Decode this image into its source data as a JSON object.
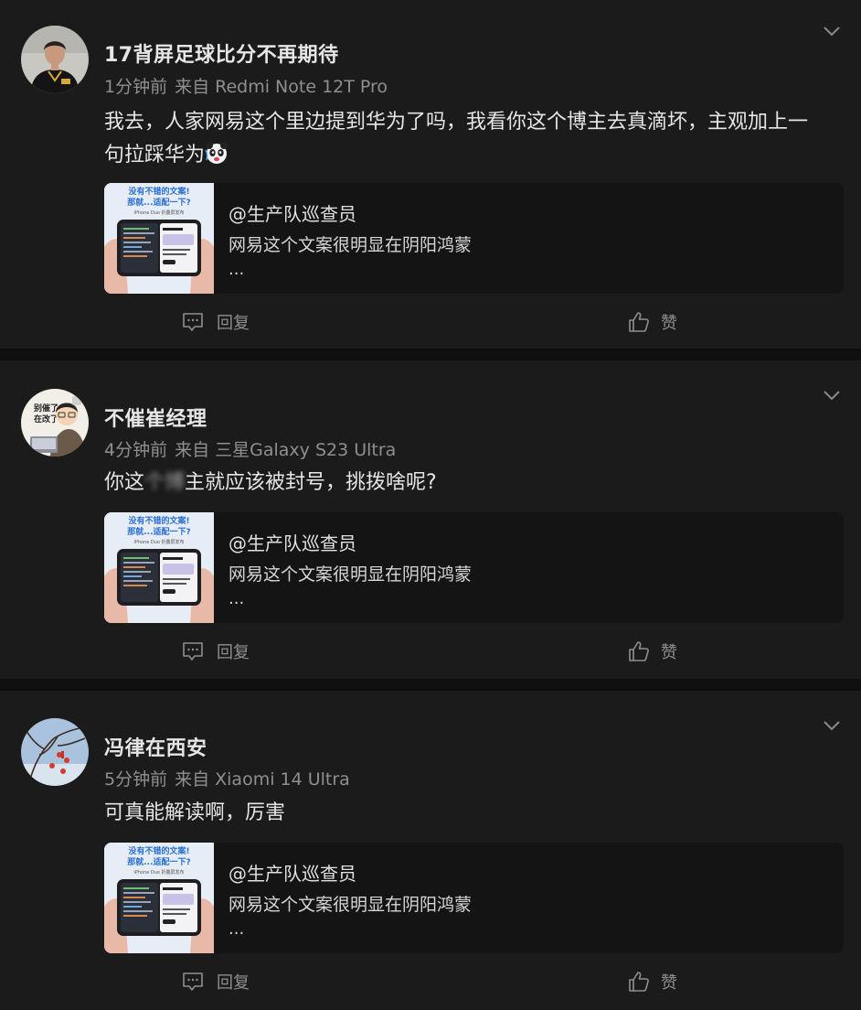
{
  "colors": {
    "background": "#0f0f0f",
    "card": "#1b1b1b",
    "quote_card": "#141414",
    "text_primary": "#e6e6e6",
    "text_secondary": "#8f8f8f"
  },
  "posts": [
    {
      "username": "17背屏足球比分不再期待",
      "time": "1分钟前",
      "source": "来自 Redmi Note 12T Pro",
      "content": "我去，人家网易这个里边提到华为了吗，我看你这个博主去真滴坏，主观加上一句拉踩华为",
      "emoji": "panda-emoji-icon",
      "quote": {
        "author": "@生产队巡查员",
        "text": "网易这个文案很明显在阴阳鸿蒙",
        "more": "..."
      },
      "reply_label": "回复",
      "like_label": "赞"
    },
    {
      "username": "不催崔经理",
      "time": "4分钟前",
      "source": "来自 三星Galaxy S23 Ultra",
      "content_before": "你这",
      "content_obscured": "个博",
      "content_after": "主就应该被封号，挑拨啥呢?",
      "quote": {
        "author": "@生产队巡查员",
        "text": "网易这个文案很明显在阴阳鸿蒙",
        "more": "..."
      },
      "reply_label": "回复",
      "like_label": "赞"
    },
    {
      "username": "冯律在西安",
      "time": "5分钟前",
      "source": "来自 Xiaomi 14 Ultra",
      "content": "可真能解读啊，厉害",
      "quote": {
        "author": "@生产队巡查员",
        "text": "网易这个文案很明显在阴阳鸿蒙",
        "more": "..."
      },
      "reply_label": "回复",
      "like_label": "赞"
    }
  ],
  "thumbnail": {
    "headline_line1": "没有不错的文案!",
    "headline_line2": "那就...适配一下?",
    "caption": "iPhone Duo 折叠屏发布"
  }
}
